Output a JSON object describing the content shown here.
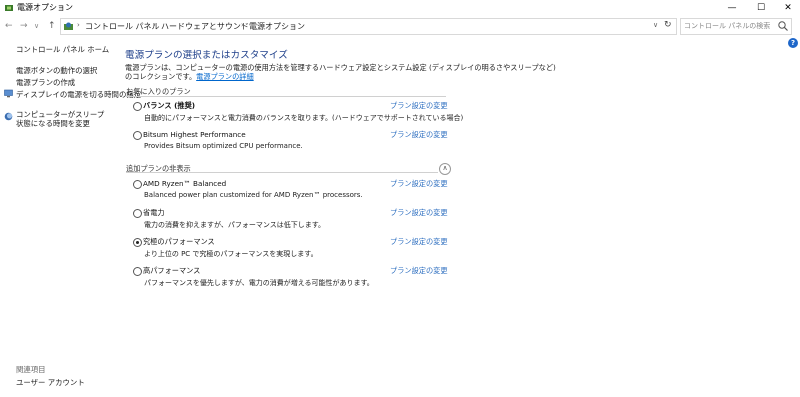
{
  "window": {
    "title": "電源オプション"
  },
  "titlebar_buttons": {
    "minimize": "—",
    "maximize": "☐",
    "close": "✕"
  },
  "nav": {
    "back": "←",
    "forward": "→",
    "dropdown": "∨",
    "up": "↑"
  },
  "breadcrumb": [
    "コントロール パネル",
    "ハードウェアとサウンド",
    "電源オプション"
  ],
  "search": {
    "placeholder": "コントロール パネルの検索"
  },
  "sidebar": {
    "home": "コントロール パネル ホーム",
    "items": [
      "電源ボタンの動作の選択",
      "電源プランの作成",
      "ディスプレイの電源を切る時間の指定",
      "コンピューターがスリープ状態になる時間を変更"
    ],
    "related_heading": "関連項目",
    "related_items": [
      "ユーザー アカウント"
    ]
  },
  "main": {
    "title": "電源プランの選択またはカスタマイズ",
    "description_line1": "電源プランは、コンピューターの電源の使用方法を管理するハードウェア設定とシステム設定 (ディスプレイの明るさやスリープなど)",
    "description_line2": "のコレクションです。",
    "description_link": "電源プランの詳細",
    "favorites_label": "お気に入りのプラン",
    "hidden_label": "追加プランの非表示",
    "change_link": "プラン設定の変更",
    "favorite_plans": [
      {
        "name": "バランス (推奨)",
        "desc": "自動的にパフォーマンスと電力消費のバランスを取ります。(ハードウェアでサポートされている場合)",
        "selected": false
      },
      {
        "name": "Bitsum Highest Performance",
        "desc": "Provides Bitsum optimized CPU performance.",
        "selected": false
      }
    ],
    "additional_plans": [
      {
        "name": "AMD Ryzen™ Balanced",
        "desc": "Balanced power plan customized for AMD Ryzen™ processors.",
        "selected": false
      },
      {
        "name": "省電力",
        "desc": "電力の消費を抑えますが、パフォーマンスは低下します。",
        "selected": false
      },
      {
        "name": "究極のパフォーマンス",
        "desc": "より上位の PC で究極のパフォーマンスを実現します。",
        "selected": true
      },
      {
        "name": "高パフォーマンス",
        "desc": "パフォーマンスを優先しますが、電力の消費が増える可能性があります。",
        "selected": false
      }
    ]
  },
  "colors": {
    "title_blue": "#1e3f8a",
    "link_blue": "#2e6fc0",
    "help_blue": "#1d66c9"
  }
}
